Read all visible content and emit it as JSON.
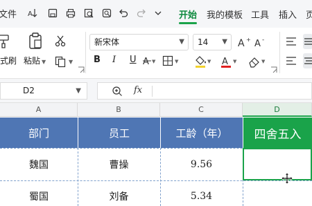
{
  "menubar": {
    "file_label": "文件",
    "tabs": [
      {
        "label": "开始",
        "active": true
      },
      {
        "label": "我的模板",
        "active": false
      },
      {
        "label": "工具",
        "active": false
      },
      {
        "label": "插入",
        "active": false
      },
      {
        "label": "页",
        "active": false
      }
    ]
  },
  "ribbon": {
    "format_painter_label": "式刷",
    "paste_label": "粘贴",
    "font_name": "新宋体",
    "font_size": "14",
    "bold": "B",
    "italic": "I",
    "underline": "U"
  },
  "formula_bar": {
    "cell_ref": "D2",
    "fx_label": "fx",
    "formula": ""
  },
  "sheet": {
    "columns": [
      "A",
      "B",
      "C",
      "D"
    ],
    "selected_column": "D",
    "headers": [
      "部门",
      "员工",
      "工龄（年）",
      "四舍五入"
    ],
    "rows": [
      [
        "魏国",
        "曹操",
        "9.56",
        ""
      ],
      [
        "蜀国",
        "刘备",
        "5.34",
        ""
      ]
    ]
  },
  "colors": {
    "accent_green": "#1aa34a",
    "header_blue": "#4f76b4",
    "font_color_red": "#e02020"
  }
}
